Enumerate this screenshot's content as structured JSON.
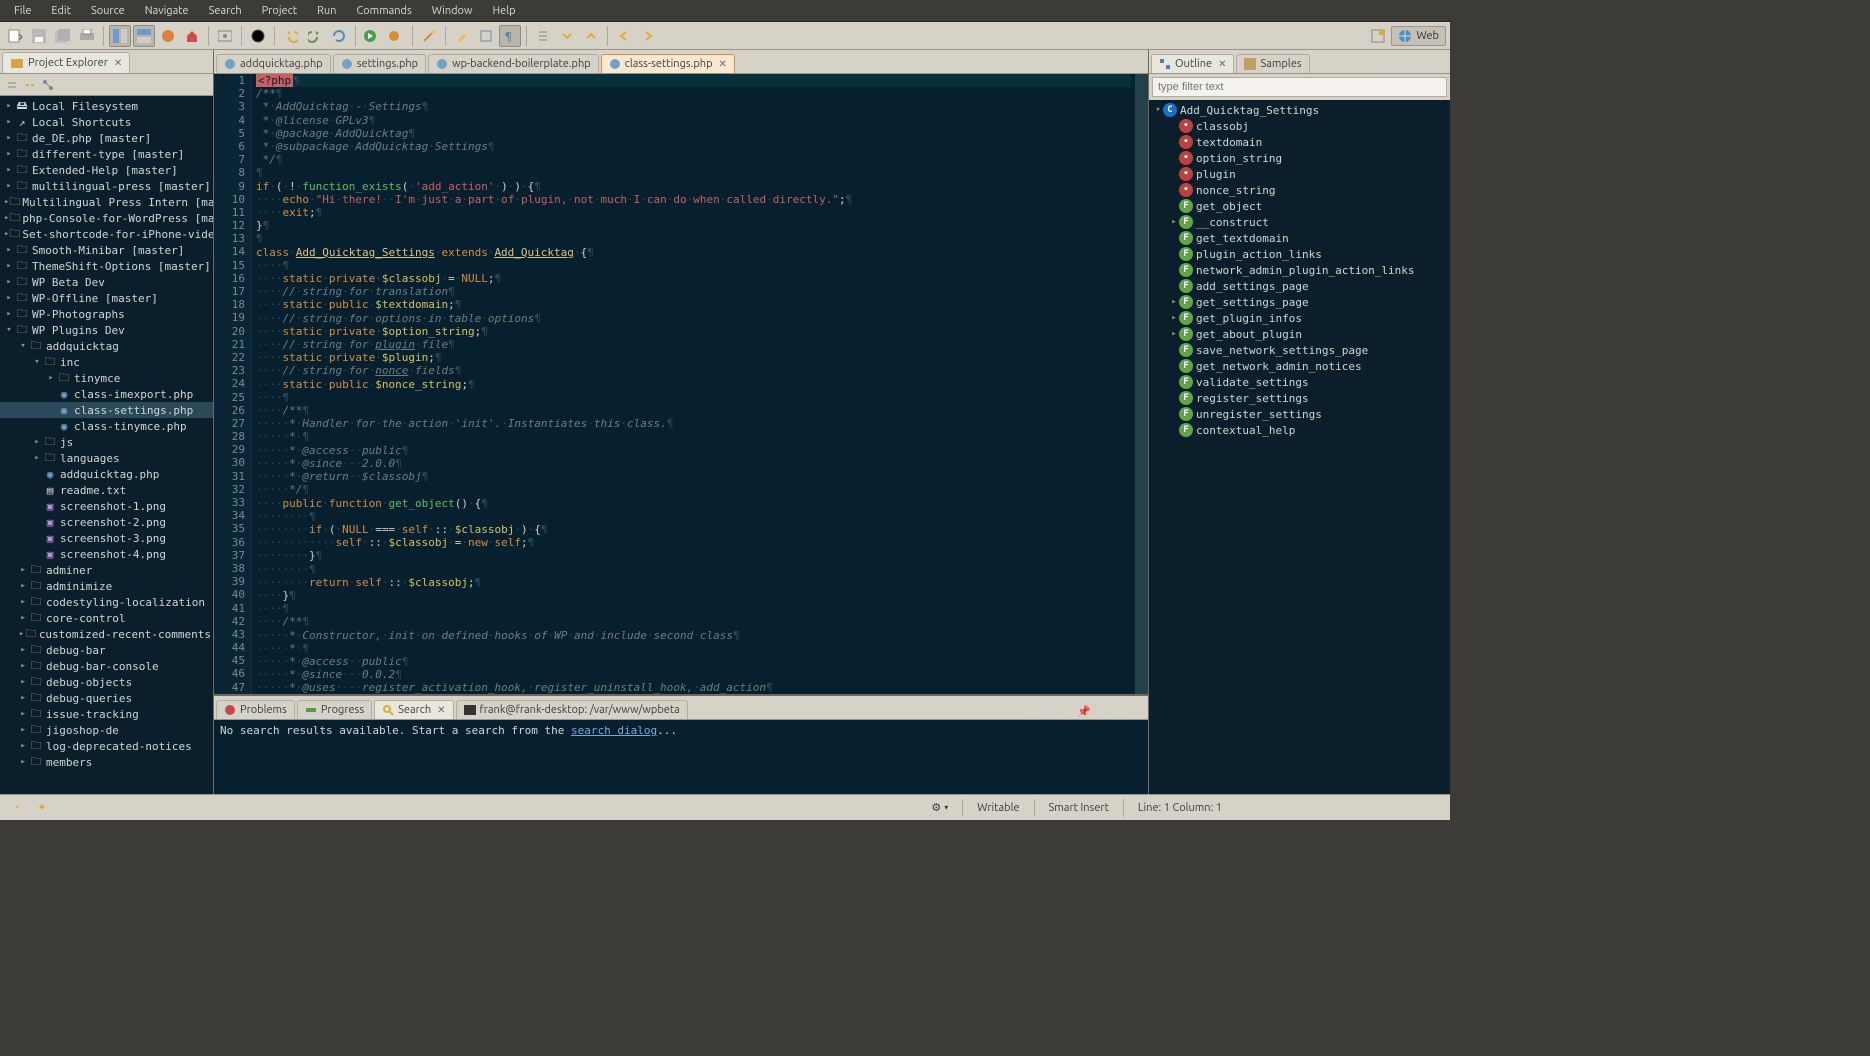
{
  "menubar": [
    "File",
    "Edit",
    "Source",
    "Navigate",
    "Search",
    "Project",
    "Run",
    "Commands",
    "Window",
    "Help"
  ],
  "perspective": {
    "web": "Web"
  },
  "project_explorer": {
    "title": "Project Explorer",
    "items": [
      {
        "d": 0,
        "t": "local",
        "l": "Local Filesystem",
        "e": false
      },
      {
        "d": 0,
        "t": "shortcut",
        "l": "Local Shortcuts",
        "e": false
      },
      {
        "d": 0,
        "t": "folder",
        "l": "de_DE.php [master]",
        "e": true
      },
      {
        "d": 0,
        "t": "folder",
        "l": "different-type [master]",
        "e": true
      },
      {
        "d": 0,
        "t": "folder",
        "l": "Extended-Help [master]",
        "e": false
      },
      {
        "d": 0,
        "t": "folder",
        "l": "multilingual-press [master]",
        "e": true
      },
      {
        "d": 0,
        "t": "folder",
        "l": "Multilingual Press Intern [master]",
        "e": true
      },
      {
        "d": 0,
        "t": "folder",
        "l": "php-Console-for-WordPress [master]",
        "e": true
      },
      {
        "d": 0,
        "t": "folder",
        "l": "Set-shortcode-for-iPhone-video-tag",
        "e": true
      },
      {
        "d": 0,
        "t": "folder",
        "l": "Smooth-Minibar [master]",
        "e": true
      },
      {
        "d": 0,
        "t": "folder",
        "l": "ThemeShift-Options [master]",
        "e": true
      },
      {
        "d": 0,
        "t": "wp",
        "l": "WP Beta Dev",
        "e": false
      },
      {
        "d": 0,
        "t": "folder",
        "l": "WP-Offline [master]",
        "e": true
      },
      {
        "d": 0,
        "t": "wp",
        "l": "WP-Photographs",
        "e": false
      },
      {
        "d": 0,
        "t": "wp",
        "l": "WP Plugins Dev",
        "e": true,
        "open": true
      },
      {
        "d": 1,
        "t": "folder",
        "l": "addquicktag",
        "e": true,
        "open": true
      },
      {
        "d": 2,
        "t": "folder",
        "l": "inc",
        "e": true,
        "open": true
      },
      {
        "d": 3,
        "t": "folder",
        "l": "tinymce",
        "e": false
      },
      {
        "d": 3,
        "t": "php",
        "l": "class-imexport.php"
      },
      {
        "d": 3,
        "t": "php",
        "l": "class-settings.php",
        "sel": true
      },
      {
        "d": 3,
        "t": "php",
        "l": "class-tinymce.php"
      },
      {
        "d": 2,
        "t": "folder",
        "l": "js",
        "e": true
      },
      {
        "d": 2,
        "t": "folder",
        "l": "languages",
        "e": true
      },
      {
        "d": 2,
        "t": "php",
        "l": "addquicktag.php"
      },
      {
        "d": 2,
        "t": "txt",
        "l": "readme.txt"
      },
      {
        "d": 2,
        "t": "img",
        "l": "screenshot-1.png"
      },
      {
        "d": 2,
        "t": "img",
        "l": "screenshot-2.png"
      },
      {
        "d": 2,
        "t": "img",
        "l": "screenshot-3.png"
      },
      {
        "d": 2,
        "t": "img",
        "l": "screenshot-4.png"
      },
      {
        "d": 1,
        "t": "folder",
        "l": "adminer",
        "e": true
      },
      {
        "d": 1,
        "t": "folder",
        "l": "adminimize",
        "e": true
      },
      {
        "d": 1,
        "t": "folder",
        "l": "codestyling-localization",
        "e": true
      },
      {
        "d": 1,
        "t": "folder",
        "l": "core-control",
        "e": true
      },
      {
        "d": 1,
        "t": "folder",
        "l": "customized-recent-comments",
        "e": false
      },
      {
        "d": 1,
        "t": "folder",
        "l": "debug-bar",
        "e": true
      },
      {
        "d": 1,
        "t": "folder",
        "l": "debug-bar-console",
        "e": true
      },
      {
        "d": 1,
        "t": "folder",
        "l": "debug-objects",
        "e": true
      },
      {
        "d": 1,
        "t": "folder",
        "l": "debug-queries",
        "e": true
      },
      {
        "d": 1,
        "t": "folder",
        "l": "issue-tracking",
        "e": true
      },
      {
        "d": 1,
        "t": "folder",
        "l": "jigoshop-de",
        "e": true
      },
      {
        "d": 1,
        "t": "folder",
        "l": "log-deprecated-notices",
        "e": true
      },
      {
        "d": 1,
        "t": "folder",
        "l": "members",
        "e": true
      }
    ]
  },
  "editor_tabs": [
    {
      "label": "addquicktag.php",
      "icon": "php"
    },
    {
      "label": "settings.php",
      "icon": "php"
    },
    {
      "label": "wp-backend-boilerplate.php",
      "icon": "php"
    },
    {
      "label": "class-settings.php",
      "icon": "php",
      "active": true
    }
  ],
  "code_lines": [
    {
      "n": 1,
      "h": "<span class='php-tag'>&lt;?php</span><span class='ws'>¶</span>"
    },
    {
      "n": 2,
      "h": "<span class='cmt'>/**</span><span class='ws'>¶</span>"
    },
    {
      "n": 3,
      "h": "<span class='cmt'> *</span><span class='ws'>·</span><span class='cmt'>AddQuicktag</span><span class='ws'>·</span><span class='cmt'>-</span><span class='ws'>·</span><span class='cmt'>Settings</span><span class='ws'>¶</span>"
    },
    {
      "n": 4,
      "h": "<span class='cmt'> *</span><span class='ws'>·</span><span class='cmt'>@license</span><span class='ws'>·</span><span class='cmt'>GPLv3</span><span class='ws'>¶</span>"
    },
    {
      "n": 5,
      "h": "<span class='cmt'> *</span><span class='ws'>·</span><span class='cmt'>@package</span><span class='ws'>·</span><span class='cmt'>AddQuicktag</span><span class='ws'>¶</span>"
    },
    {
      "n": 6,
      "h": "<span class='cmt'> *</span><span class='ws'>·</span><span class='cmt'>@subpackage</span><span class='ws'>·</span><span class='cmt'>AddQuicktag</span><span class='ws'>·</span><span class='cmt'>Settings</span><span class='ws'>¶</span>"
    },
    {
      "n": 7,
      "h": "<span class='cmt'> */</span><span class='ws'>¶</span>"
    },
    {
      "n": 8,
      "h": "<span class='ws'>¶</span>"
    },
    {
      "n": 9,
      "h": "<span class='kw'>if</span><span class='ws'>·</span>(<span class='ws'>·</span>!<span class='ws'>·</span><span class='fn'>function_exists</span>(<span class='ws'>·</span><span class='str'>'add_action'</span><span class='ws'>·</span>)<span class='ws'>·</span>)<span class='ws'>·</span>{<span class='ws'>¶</span>"
    },
    {
      "n": 10,
      "h": "<span class='ws'>····</span><span class='kw'>echo</span><span class='ws'>·</span><span class='str'>\"Hi</span><span class='ws'>·</span><span class='str'>there!</span><span class='ws'>··</span><span class='str'>I'm</span><span class='ws'>·</span><span class='str'>just</span><span class='ws'>·</span><span class='str'>a</span><span class='ws'>·</span><span class='str'>part</span><span class='ws'>·</span><span class='str'>of</span><span class='ws'>·</span><span class='str'>plugin,</span><span class='ws'>·</span><span class='str'>not</span><span class='ws'>·</span><span class='str'>much</span><span class='ws'>·</span><span class='str'>I</span><span class='ws'>·</span><span class='str'>can</span><span class='ws'>·</span><span class='str'>do</span><span class='ws'>·</span><span class='str'>when</span><span class='ws'>·</span><span class='str'>called</span><span class='ws'>·</span><span class='str'>directly.\"</span>;<span class='ws'>¶</span>"
    },
    {
      "n": 11,
      "h": "<span class='ws'>····</span><span class='kw'>exit</span>;<span class='ws'>¶</span>"
    },
    {
      "n": 12,
      "h": "}<span class='ws'>¶</span>"
    },
    {
      "n": 13,
      "h": "<span class='ws'>¶</span>"
    },
    {
      "n": 14,
      "h": "<span class='kw'>class</span><span class='ws'>·</span><span class='cls'>Add_Quicktag_Settings</span><span class='ws'>·</span><span class='kw'>extends</span><span class='ws'>·</span><span class='cls'>Add_Quicktag</span><span class='ws'>·</span>{<span class='ws'>¶</span>"
    },
    {
      "n": 15,
      "h": "<span class='ws'>····¶</span>"
    },
    {
      "n": 16,
      "h": "<span class='ws'>····</span><span class='kw'>static</span><span class='ws'>·</span><span class='kw'>private</span><span class='ws'>·</span><span class='var'>$classobj</span><span class='ws'>·</span>=<span class='ws'>·</span><span class='kw'>NULL</span>;<span class='ws'>¶</span>"
    },
    {
      "n": 17,
      "h": "<span class='ws'>····</span><span class='cmt'>//</span><span class='ws'>·</span><span class='cmt'>string</span><span class='ws'>·</span><span class='cmt'>for</span><span class='ws'>·</span><span class='cmt'>translation</span><span class='ws'>¶</span>"
    },
    {
      "n": 18,
      "h": "<span class='ws'>····</span><span class='kw'>static</span><span class='ws'>·</span><span class='kw'>public</span><span class='ws'>·</span><span class='var'>$textdomain</span>;<span class='ws'>¶</span>"
    },
    {
      "n": 19,
      "h": "<span class='ws'>····</span><span class='cmt'>//</span><span class='ws'>·</span><span class='cmt'>string</span><span class='ws'>·</span><span class='cmt'>for</span><span class='ws'>·</span><span class='cmt'>options</span><span class='ws'>·</span><span class='cmt'>in</span><span class='ws'>·</span><span class='cmt'>table</span><span class='ws'>·</span><span class='cmt'>options</span><span class='ws'>¶</span>"
    },
    {
      "n": 20,
      "h": "<span class='ws'>····</span><span class='kw'>static</span><span class='ws'>·</span><span class='kw'>private</span><span class='ws'>·</span><span class='var'>$option_string</span>;<span class='ws'>¶</span>"
    },
    {
      "n": 21,
      "h": "<span class='ws'>····</span><span class='cmt'>//</span><span class='ws'>·</span><span class='cmt'>string</span><span class='ws'>·</span><span class='cmt'>for</span><span class='ws'>·</span><span class='cmt'><u>plugin</u></span><span class='ws'>·</span><span class='cmt'>file</span><span class='ws'>¶</span>"
    },
    {
      "n": 22,
      "h": "<span class='ws'>····</span><span class='kw'>static</span><span class='ws'>·</span><span class='kw'>private</span><span class='ws'>·</span><span class='var'>$plugin</span>;<span class='ws'>¶</span>"
    },
    {
      "n": 23,
      "h": "<span class='ws'>····</span><span class='cmt'>//</span><span class='ws'>·</span><span class='cmt'>string</span><span class='ws'>·</span><span class='cmt'>for</span><span class='ws'>·</span><span class='cmt'><u>nonce</u></span><span class='ws'>·</span><span class='cmt'>fields</span><span class='ws'>¶</span>"
    },
    {
      "n": 24,
      "h": "<span class='ws'>····</span><span class='kw'>static</span><span class='ws'>·</span><span class='kw'>public</span><span class='ws'>·</span><span class='var'>$nonce_string</span>;<span class='ws'>¶</span>"
    },
    {
      "n": 25,
      "h": "<span class='ws'>····¶</span>"
    },
    {
      "n": 26,
      "h": "<span class='ws'>····</span><span class='cmt'>/**</span><span class='ws'>¶</span>"
    },
    {
      "n": 27,
      "h": "<span class='ws'>·····</span><span class='cmt'>*</span><span class='ws'>·</span><span class='cmt'>Handler</span><span class='ws'>·</span><span class='cmt'>for</span><span class='ws'>·</span><span class='cmt'>the</span><span class='ws'>·</span><span class='cmt'>action</span><span class='ws'>·</span><span class='cmt'>'init'.</span><span class='ws'>·</span><span class='cmt'>Instantiates</span><span class='ws'>·</span><span class='cmt'>this</span><span class='ws'>·</span><span class='cmt'>class.</span><span class='ws'>¶</span>"
    },
    {
      "n": 28,
      "h": "<span class='ws'>·····</span><span class='cmt'>*</span><span class='ws'>·¶</span>"
    },
    {
      "n": 29,
      "h": "<span class='ws'>·····</span><span class='cmt'>*</span><span class='ws'>·</span><span class='cmt'>@access</span><span class='ws'>··</span><span class='cmt'>public</span><span class='ws'>¶</span>"
    },
    {
      "n": 30,
      "h": "<span class='ws'>·····</span><span class='cmt'>*</span><span class='ws'>·</span><span class='cmt'>@since</span><span class='ws'>···</span><span class='cmt'>2.0.0</span><span class='ws'>¶</span>"
    },
    {
      "n": 31,
      "h": "<span class='ws'>·····</span><span class='cmt'>*</span><span class='ws'>·</span><span class='cmt'>@return</span><span class='ws'>··</span><span class='cmt'>$classobj</span><span class='ws'>¶</span>"
    },
    {
      "n": 32,
      "h": "<span class='ws'>·····</span><span class='cmt'>*/</span><span class='ws'>¶</span>"
    },
    {
      "n": 33,
      "h": "<span class='ws'>····</span><span class='kw'>public</span><span class='ws'>·</span><span class='kw'>function</span><span class='ws'>·</span><span class='fn'>get_object</span>()<span class='ws'>·</span>{<span class='ws'>¶</span>"
    },
    {
      "n": 34,
      "h": "<span class='ws'>········¶</span>"
    },
    {
      "n": 35,
      "h": "<span class='ws'>········</span><span class='kw'>if</span><span class='ws'>·</span>(<span class='ws'>·</span><span class='kw'>NULL</span><span class='ws'>·</span>===<span class='ws'>·</span><span class='kw'>self</span><span class='ws'>·</span>::<span class='ws'>·</span><span class='var'>$classobj</span><span class='ws'>·</span>)<span class='ws'>·</span>{<span class='ws'>¶</span>"
    },
    {
      "n": 36,
      "h": "<span class='ws'>············</span><span class='kw'>self</span><span class='ws'>·</span>::<span class='ws'>·</span><span class='var'>$classobj</span><span class='ws'>·</span>=<span class='ws'>·</span><span class='kw'>new</span><span class='ws'>·</span><span class='kw'>self</span>;<span class='ws'>¶</span>"
    },
    {
      "n": 37,
      "h": "<span class='ws'>········</span>}<span class='ws'>¶</span>"
    },
    {
      "n": 38,
      "h": "<span class='ws'>········¶</span>"
    },
    {
      "n": 39,
      "h": "<span class='ws'>········</span><span class='kw'>return</span><span class='ws'>·</span><span class='kw'>self</span><span class='ws'>·</span>::<span class='ws'>·</span><span class='var'>$classobj</span>;<span class='ws'>¶</span>"
    },
    {
      "n": 40,
      "h": "<span class='ws'>····</span>}<span class='ws'>¶</span>"
    },
    {
      "n": 41,
      "h": "<span class='ws'>····¶</span>"
    },
    {
      "n": 42,
      "h": "<span class='ws'>····</span><span class='cmt'>/**</span><span class='ws'>¶</span>"
    },
    {
      "n": 43,
      "h": "<span class='ws'>·····</span><span class='cmt'>*</span><span class='ws'>·</span><span class='cmt'>Constructor,</span><span class='ws'>·</span><span class='cmt'>init</span><span class='ws'>·</span><span class='cmt'>on</span><span class='ws'>·</span><span class='cmt'>defined</span><span class='ws'>·</span><span class='cmt'>hooks</span><span class='ws'>·</span><span class='cmt'>of</span><span class='ws'>·</span><span class='cmt'>WP</span><span class='ws'>·</span><span class='cmt'>and</span><span class='ws'>·</span><span class='cmt'>include</span><span class='ws'>·</span><span class='cmt'>second</span><span class='ws'>·</span><span class='cmt'>class</span><span class='ws'>¶</span>"
    },
    {
      "n": 44,
      "h": "<span class='ws'>·····</span><span class='cmt'>*</span><span class='ws'>·¶</span>"
    },
    {
      "n": 45,
      "h": "<span class='ws'>·····</span><span class='cmt'>*</span><span class='ws'>·</span><span class='cmt'>@access</span><span class='ws'>··</span><span class='cmt'>public</span><span class='ws'>¶</span>"
    },
    {
      "n": 46,
      "h": "<span class='ws'>·····</span><span class='cmt'>*</span><span class='ws'>·</span><span class='cmt'>@since</span><span class='ws'>···</span><span class='cmt'>0.0.2</span><span class='ws'>¶</span>"
    },
    {
      "n": 47,
      "h": "<span class='ws'>·····</span><span class='cmt'>*</span><span class='ws'>·</span><span class='cmt'>@uses</span><span class='ws'>····</span><span class='cmt'>register_activation_hook,</span><span class='ws'>·</span><span class='cmt'>register_uninstall_hook,</span><span class='ws'>·</span><span class='cmt'>add_action</span><span class='ws'>¶</span>"
    }
  ],
  "outline": {
    "tab1": "Outline",
    "tab2": "Samples",
    "filter_placeholder": "type filter text",
    "root": "Add_Quicktag_Settings",
    "items": [
      {
        "d": 1,
        "k": "v",
        "l": "classobj"
      },
      {
        "d": 1,
        "k": "v",
        "l": "textdomain"
      },
      {
        "d": 1,
        "k": "v",
        "l": "option_string"
      },
      {
        "d": 1,
        "k": "v",
        "l": "plugin"
      },
      {
        "d": 1,
        "k": "v",
        "l": "nonce_string"
      },
      {
        "d": 1,
        "k": "f",
        "l": "get_object"
      },
      {
        "d": 1,
        "k": "f",
        "l": "__construct",
        "e": true
      },
      {
        "d": 1,
        "k": "f",
        "l": "get_textdomain"
      },
      {
        "d": 1,
        "k": "f",
        "l": "plugin_action_links"
      },
      {
        "d": 1,
        "k": "f",
        "l": "network_admin_plugin_action_links"
      },
      {
        "d": 1,
        "k": "f",
        "l": "add_settings_page"
      },
      {
        "d": 1,
        "k": "f",
        "l": "get_settings_page",
        "e": true
      },
      {
        "d": 1,
        "k": "f",
        "l": "get_plugin_infos",
        "e": true
      },
      {
        "d": 1,
        "k": "f",
        "l": "get_about_plugin",
        "e": true
      },
      {
        "d": 1,
        "k": "f",
        "l": "save_network_settings_page"
      },
      {
        "d": 1,
        "k": "f",
        "l": "get_network_admin_notices"
      },
      {
        "d": 1,
        "k": "f",
        "l": "validate_settings"
      },
      {
        "d": 1,
        "k": "f",
        "l": "register_settings"
      },
      {
        "d": 1,
        "k": "f",
        "l": "unregister_settings"
      },
      {
        "d": 1,
        "k": "f",
        "l": "contextual_help"
      }
    ]
  },
  "bottom_tabs": {
    "problems": "Problems",
    "progress": "Progress",
    "search": "Search",
    "terminal": "frank@frank-desktop: /var/www/wpbeta"
  },
  "search_msg_pre": "No search results available. Start a search from the ",
  "search_link": "search dialog",
  "search_msg_post": "...",
  "status": {
    "writable": "Writable",
    "insert": "Smart Insert",
    "line": "Line: 1 Column: 1"
  }
}
